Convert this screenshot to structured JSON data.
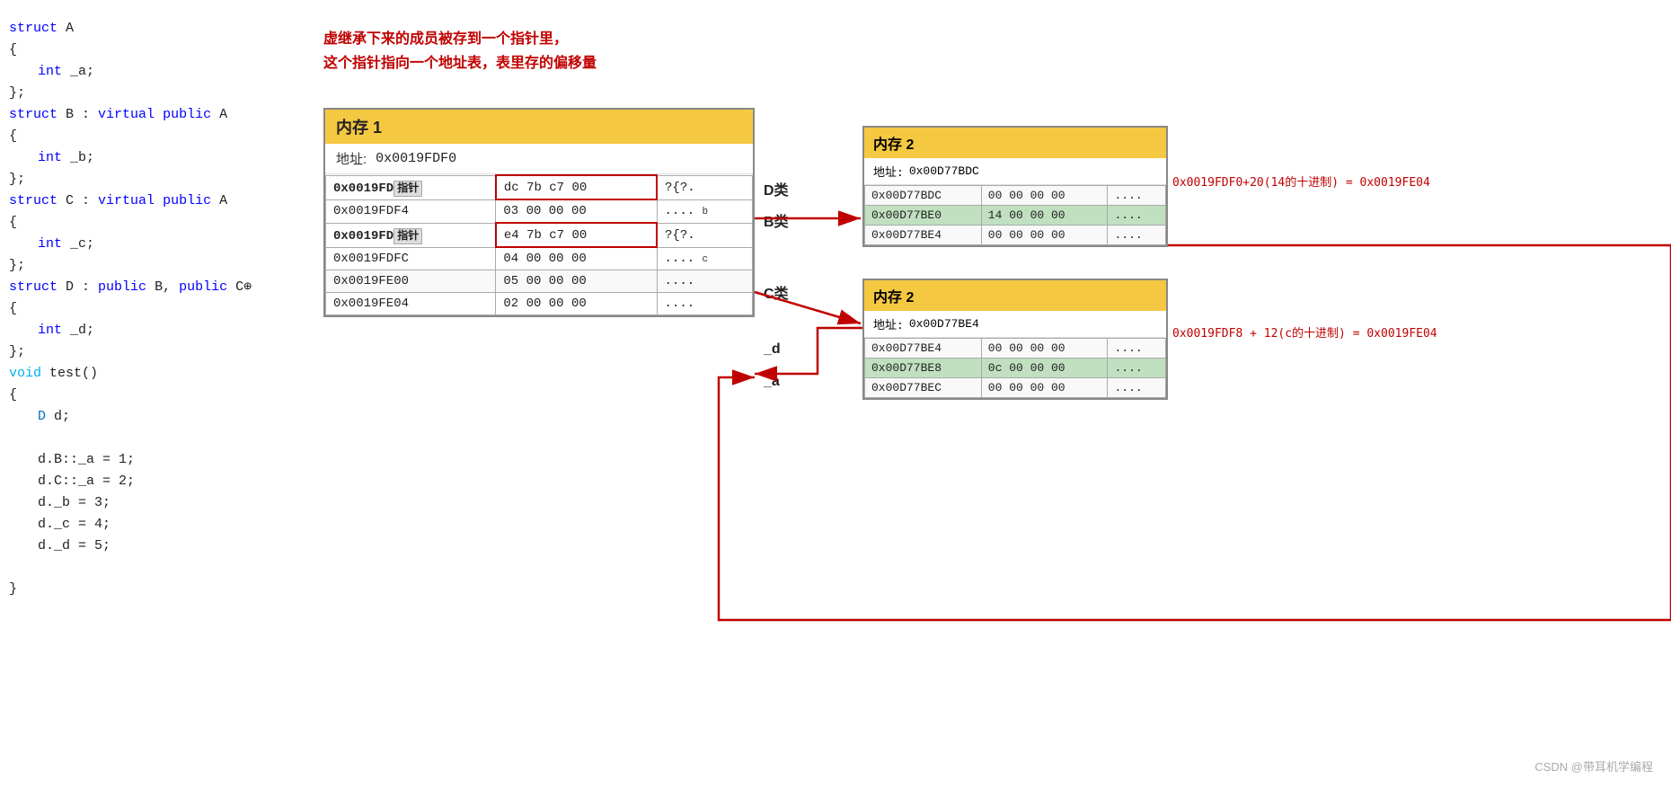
{
  "annotation": {
    "line1": "虚继承下来的成员被存到一个指针里，",
    "line2": "这个指针指向一个地址表，表里存的偏移量"
  },
  "memory1": {
    "title": "内存 1",
    "address_label": "地址:",
    "address_value": "0x0019FDF0",
    "rows": [
      {
        "addr": "0x0019FD",
        "suffix": "指针",
        "hex": "dc 7b c7 00",
        "ascii": "?{?.",
        "label": "B类"
      },
      {
        "addr": "0x0019FDF4",
        "hex": "03 00 00 00",
        "ascii": "....",
        "label": "b"
      },
      {
        "addr": "0x0019FD",
        "suffix": "指针",
        "hex": "e4 7b c7 00",
        "ascii": "?{?.",
        "label": "C类"
      },
      {
        "addr": "0x0019FDFC",
        "hex": "04 00 00 00",
        "ascii": "....",
        "label": "c"
      },
      {
        "addr": "0x0019FE00",
        "hex": "05 00 00 00",
        "ascii": "....",
        "label": "_d"
      },
      {
        "addr": "0x0019FE04",
        "hex": "02 00 00 00",
        "ascii": "....",
        "label": "_a"
      }
    ]
  },
  "memory2_upper": {
    "title": "内存 2",
    "address_label": "地址:",
    "address_value": "0x00D77BDC",
    "equation": "0x0019FDF0+20(14的十进制) = 0x0019FE04",
    "rows": [
      {
        "addr": "0x00D77BDC",
        "hex": "00 00 00 00",
        "ascii": "...."
      },
      {
        "addr": "0x00D77BE0",
        "hex": "14 00 00 00",
        "ascii": "...."
      },
      {
        "addr": "0x00D77BE4",
        "hex": "00 00 00 00",
        "ascii": "...."
      }
    ],
    "highlighted_row": 1
  },
  "memory2_lower": {
    "title": "内存 2",
    "address_label": "地址:",
    "address_value": "0x00D77BE4",
    "equation": "0x0019FDF8 + 12(c的十进制) = 0x0019FE04",
    "rows": [
      {
        "addr": "0x00D77BE4",
        "hex": "00 00 00 00",
        "ascii": "...."
      },
      {
        "addr": "0x00D77BE8",
        "hex": "0c 00 00 00",
        "ascii": "...."
      },
      {
        "addr": "0x00D77BEC",
        "hex": "00 00 00 00",
        "ascii": "...."
      }
    ],
    "highlighted_row": 1
  },
  "code": {
    "lines": [
      {
        "text": "struct A",
        "type": "kw-plain"
      },
      {
        "text": "{",
        "type": "plain"
      },
      {
        "text": "    int _a;",
        "type": "indent"
      },
      {
        "text": "};",
        "type": "plain"
      },
      {
        "text": "struct B : virtual public A",
        "type": "kw-plain"
      },
      {
        "text": "{",
        "type": "plain"
      },
      {
        "text": "    int _b;",
        "type": "indent"
      },
      {
        "text": "};",
        "type": "plain"
      },
      {
        "text": "struct C : virtual public A",
        "type": "kw-plain"
      },
      {
        "text": "{",
        "type": "plain"
      },
      {
        "text": "    int _c;",
        "type": "indent"
      },
      {
        "text": "};",
        "type": "plain"
      },
      {
        "text": "struct D : public B, public C⊕",
        "type": "kw-plain"
      },
      {
        "text": "{",
        "type": "plain"
      },
      {
        "text": "    int _d;",
        "type": "indent"
      },
      {
        "text": "};",
        "type": "plain"
      },
      {
        "text": "void test()",
        "type": "func-plain"
      },
      {
        "text": "{",
        "type": "plain"
      },
      {
        "text": "    D d;",
        "type": "indent-blue"
      },
      {
        "text": "",
        "type": "empty"
      },
      {
        "text": "    d.B::_a = 1;",
        "type": "indent"
      },
      {
        "text": "    d.C::_a = 2;",
        "type": "indent"
      },
      {
        "text": "    d._b = 3;",
        "type": "indent"
      },
      {
        "text": "    d._c = 4;",
        "type": "indent"
      },
      {
        "text": "    d._d = 5;",
        "type": "indent"
      },
      {
        "text": "",
        "type": "empty"
      },
      {
        "text": "}",
        "type": "plain"
      }
    ]
  },
  "class_labels": {
    "D": "D类",
    "B": "B类",
    "C": "C类"
  },
  "watermark": "CSDN @带耳机学编程"
}
